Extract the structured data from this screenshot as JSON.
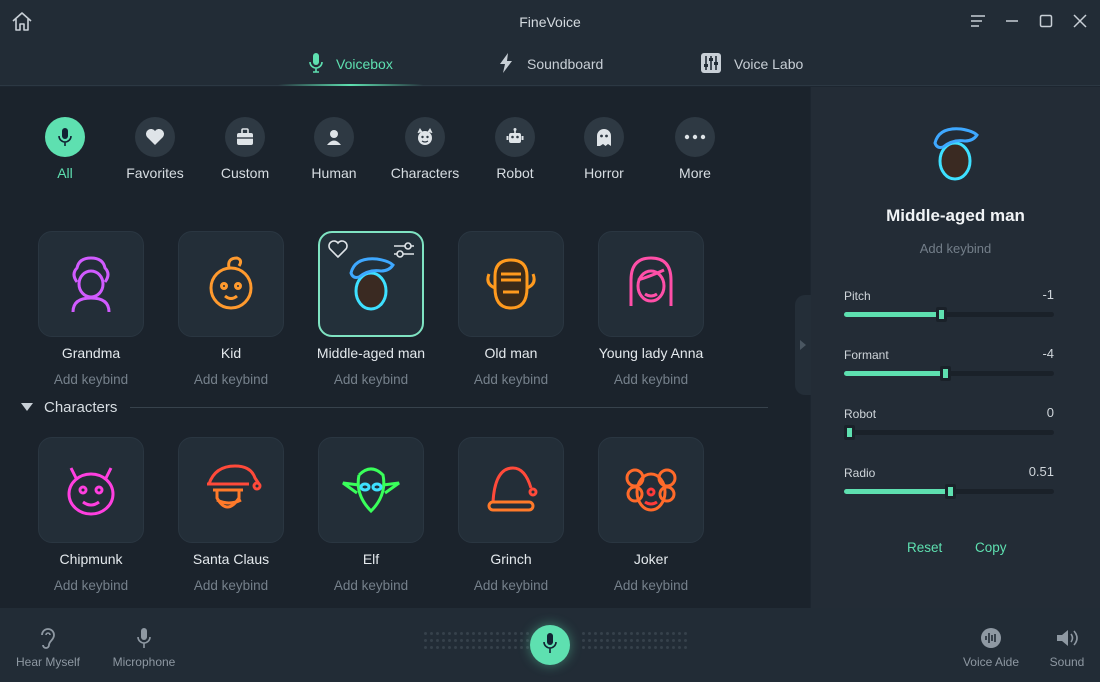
{
  "app": {
    "title": "FineVoice"
  },
  "tabs": [
    {
      "label": "Voicebox",
      "icon": "microphone-icon",
      "active": true
    },
    {
      "label": "Soundboard",
      "icon": "lightning-icon",
      "active": false
    },
    {
      "label": "Voice Labo",
      "icon": "equalizer-icon",
      "active": false
    }
  ],
  "categories": [
    {
      "label": "All",
      "icon": "microphone-icon",
      "active": true
    },
    {
      "label": "Favorites",
      "icon": "heart-icon"
    },
    {
      "label": "Custom",
      "icon": "briefcase-icon"
    },
    {
      "label": "Human",
      "icon": "person-icon"
    },
    {
      "label": "Characters",
      "icon": "devil-face-icon"
    },
    {
      "label": "Robot",
      "icon": "robot-icon"
    },
    {
      "label": "Horror",
      "icon": "ghost-icon"
    },
    {
      "label": "More",
      "icon": "more-dots-icon"
    }
  ],
  "voices_top": [
    {
      "name": "Grandma",
      "keybind": "Add keybind",
      "color": "#d15bff"
    },
    {
      "name": "Kid",
      "keybind": "Add keybind",
      "color": "#ff9a2e"
    },
    {
      "name": "Middle-aged man",
      "keybind": "Add keybind",
      "color": "#3ee0ff",
      "selected": true
    },
    {
      "name": "Old man",
      "keybind": "Add keybind",
      "color": "#ff9a1e"
    },
    {
      "name": "Young lady Anna",
      "keybind": "Add keybind",
      "color": "#ff4fa8"
    }
  ],
  "section": {
    "title": "Characters"
  },
  "voices_chars": [
    {
      "name": "Chipmunk",
      "keybind": "Add keybind",
      "color": "#ff3fe0"
    },
    {
      "name": "Santa Claus",
      "keybind": "Add keybind",
      "color": "#ff4a3a"
    },
    {
      "name": "Elf",
      "keybind": "Add keybind",
      "color": "#39ff5a"
    },
    {
      "name": "Grinch",
      "keybind": "Add keybind",
      "color": "#ff4a3a"
    },
    {
      "name": "Joker",
      "keybind": "Add keybind",
      "color": "#ff6a2a"
    }
  ],
  "selected_voice": {
    "name": "Middle-aged man",
    "keybind": "Add keybind",
    "sliders": [
      {
        "label": "Pitch",
        "value": "-1",
        "fraction": 0.46
      },
      {
        "label": "Formant",
        "value": "-4",
        "fraction": 0.48
      },
      {
        "label": "Robot",
        "value": "0",
        "fraction": 0.0
      },
      {
        "label": "Radio",
        "value": "0.51",
        "fraction": 0.505
      }
    ],
    "reset_label": "Reset",
    "copy_label": "Copy"
  },
  "bottom": {
    "hear_myself": "Hear Myself",
    "microphone": "Microphone",
    "voice_aide": "Voice Aide",
    "sound": "Sound"
  },
  "colors": {
    "accent": "#5ee0b0"
  }
}
